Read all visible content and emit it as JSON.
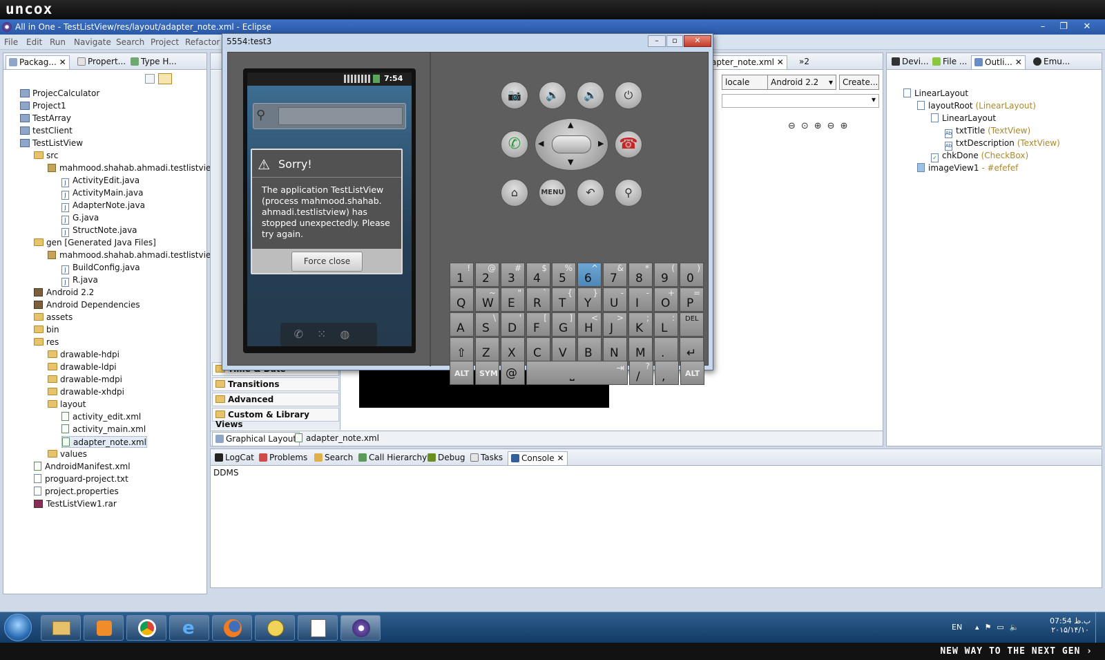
{
  "brand": "uncox",
  "window": {
    "title": "All in One - TestListView/res/layout/adapter_note.xml - Eclipse"
  },
  "menu": [
    "File",
    "Edit",
    "Run",
    "Navigate",
    "Search",
    "Project",
    "Refactor"
  ],
  "left_tabs": [
    "Packag...",
    "Propert...",
    "Type H..."
  ],
  "tree": [
    "ProjecCalculator",
    "Project1",
    "TestArray",
    "testClient",
    "TestListView",
    "src",
    "mahmood.shahab.ahmadi.testlistview",
    "ActivityEdit.java",
    "ActivityMain.java",
    "AdapterNote.java",
    "G.java",
    "StructNote.java",
    "gen [Generated Java Files]",
    "mahmood.shahab.ahmadi.testlistview",
    "BuildConfig.java",
    "R.java",
    "Android 2.2",
    "Android Dependencies",
    "assets",
    "bin",
    "res",
    "drawable-hdpi",
    "drawable-ldpi",
    "drawable-mdpi",
    "drawable-xhdpi",
    "layout",
    "activity_edit.xml",
    "activity_main.xml",
    "adapter_note.xml",
    "values",
    "AndroidManifest.xml",
    "proguard-project.txt",
    "project.properties",
    "TestListView1.rar"
  ],
  "editor": {
    "tab_label": "apter_note.xml",
    "overflow": "2",
    "locale": "locale",
    "android": "Android 2.2",
    "create": "Create...",
    "palette": [
      "Time & Date",
      "Transitions",
      "Advanced",
      "Custom & Library Views"
    ],
    "bottom_tabs": [
      "Graphical Layout",
      "adapter_note.xml"
    ]
  },
  "right_tabs": [
    "Devi...",
    "File ...",
    "Outli...",
    "Emu..."
  ],
  "outline": [
    {
      "name": "LinearLayout",
      "type": ""
    },
    {
      "name": "layoutRoot",
      "type": "(LinearLayout)"
    },
    {
      "name": "LinearLayout",
      "type": ""
    },
    {
      "name": "txtTitle",
      "type": "(TextView)"
    },
    {
      "name": "txtDescription",
      "type": "(TextView)"
    },
    {
      "name": "chkDone",
      "type": "(CheckBox)"
    },
    {
      "name": "imageView1",
      "type": "- #efefef"
    }
  ],
  "bottom_tabs": [
    "LogCat",
    "Problems",
    "Search",
    "Call Hierarchy",
    "Debug",
    "Tasks",
    "Console"
  ],
  "console": {
    "label": "DDMS"
  },
  "emulator": {
    "title": "5554:test3",
    "time": "7:54",
    "dialog": {
      "title": "Sorry!",
      "message": "The application TestListView (process mahmood.shahab. ahmadi.testlistview) has stopped unexpectedly. Please try again.",
      "button": "Force close"
    },
    "menu_btn": "MENU",
    "keys": [
      [
        [
          "1",
          "!"
        ],
        [
          "2",
          "@"
        ],
        [
          "3",
          "#"
        ],
        [
          "4",
          "$"
        ],
        [
          "5",
          "%"
        ],
        [
          "6",
          "^"
        ],
        [
          "7",
          "&"
        ],
        [
          "8",
          "*"
        ],
        [
          "9",
          "("
        ],
        [
          "0",
          ")"
        ]
      ],
      [
        [
          "Q",
          ""
        ],
        [
          "W",
          "~"
        ],
        [
          "E",
          "\""
        ],
        [
          "R",
          "`"
        ],
        [
          "T",
          "{"
        ],
        [
          "Y",
          "}"
        ],
        [
          "U",
          "-"
        ],
        [
          "I",
          "-"
        ],
        [
          "O",
          "+"
        ],
        [
          "P",
          "="
        ]
      ],
      [
        [
          "A",
          ""
        ],
        [
          "S",
          "\\"
        ],
        [
          "D",
          "'"
        ],
        [
          "F",
          "["
        ],
        [
          "G",
          "]"
        ],
        [
          "H",
          "<"
        ],
        [
          "J",
          ">"
        ],
        [
          "K",
          ";"
        ],
        [
          "L",
          ":"
        ],
        [
          "DEL",
          ""
        ]
      ],
      [
        [
          "⇧",
          ""
        ],
        [
          "Z",
          ""
        ],
        [
          "X",
          ""
        ],
        [
          "C",
          ""
        ],
        [
          "V",
          ""
        ],
        [
          "B",
          ""
        ],
        [
          "N",
          ""
        ],
        [
          "M",
          ""
        ],
        [
          ".",
          ""
        ],
        [
          "↵",
          ""
        ]
      ]
    ],
    "last_row": {
      "alt": "ALT",
      "sym": "SYM",
      "at": "@",
      "slash": "/",
      "q": "?",
      "comma": ","
    }
  },
  "taskbar": {
    "lang": "EN",
    "time": "07:54 ب.ظ",
    "date": "۲۰۱۵/۱۴/۱۰"
  },
  "slogan": "NEW WAY TO THE NEXT GEN ›"
}
